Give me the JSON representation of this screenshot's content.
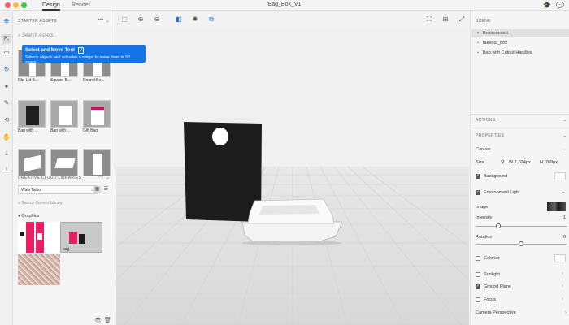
{
  "titlebar": {
    "tabs": [
      "Design",
      "Render"
    ],
    "doc_title": "Bag_Box_V1"
  },
  "tooltip": {
    "title": "Select and Move Tool",
    "shortcut": "V",
    "description": "Selects objects and activates a widget to move them in 3D space."
  },
  "starter_assets": {
    "header": "STARTER ASSETS",
    "more": "•••",
    "search_placeholder": "Search Assets...",
    "items": [
      {
        "label": "Flip Lid B..."
      },
      {
        "label": "Square B..."
      },
      {
        "label": "Round Bo..."
      },
      {
        "label": "Bag with ..."
      },
      {
        "label": "Bag with ..."
      },
      {
        "label": "Gift Bag"
      },
      {
        "label": ""
      },
      {
        "label": ""
      },
      {
        "label": ""
      }
    ]
  },
  "cc_libraries": {
    "header": "CREATIVE CLOUD LIBRARIES",
    "more": "•••",
    "selected_library": "Waki Taiku",
    "search_placeholder": "Search Current Library",
    "group": "Graphics",
    "thumb_caption": "bag"
  },
  "scene": {
    "header": "SCENE",
    "items": [
      "Environment",
      "takeout_box",
      "Bag with Cutout Handles"
    ]
  },
  "actions": {
    "header": "ACTIONS"
  },
  "properties": {
    "header": "PROPERTIES",
    "canvas_label": "Canvas",
    "size_label": "Size",
    "width_label": "W",
    "width_value": "1,024px",
    "height_label": "H",
    "height_value": "768px",
    "background_label": "Background",
    "env_light_label": "Environment Light",
    "image_label": "Image",
    "intensity_label": "Intensity",
    "intensity_value": "1",
    "intensity_level": 0.25,
    "rotation_label": "Rotation",
    "rotation_value": "0",
    "rotation_level": 0.5,
    "colorize_label": "Colorize",
    "sunlight_label": "Sunlight",
    "ground_plane_label": "Ground Plane",
    "focus_label": "Focus",
    "camera_perspective_label": "Camera Perspective"
  },
  "colors": {
    "accent": "#1473e6",
    "bag": "#1c1c1c",
    "viewport_bg": "#f0f0f0"
  }
}
